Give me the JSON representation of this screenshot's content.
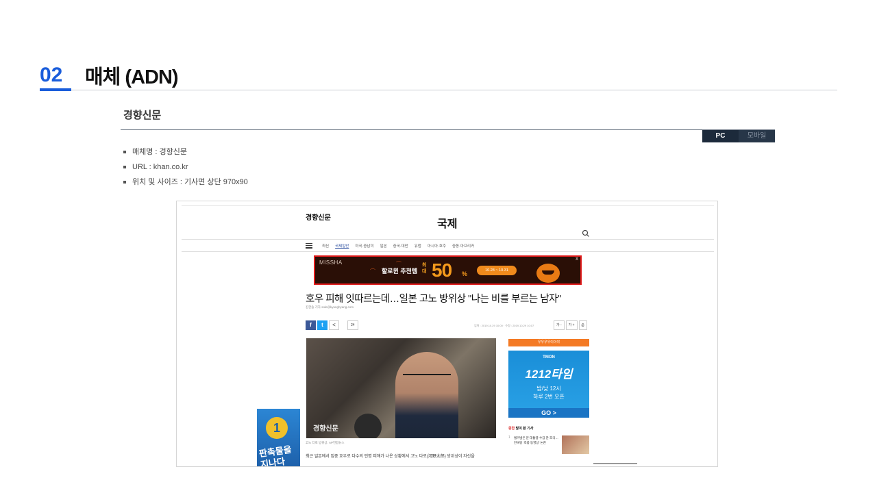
{
  "header": {
    "number": "02",
    "title": "매체 (ADN)"
  },
  "media": {
    "name": "경향신문",
    "tabs": {
      "pc": "PC",
      "mobile": "모바일"
    },
    "info": [
      "매체명 : 경향신문",
      "URL : khan.co.kr",
      "위치 및 사이즈 : 기사면 상단 970x90"
    ]
  },
  "screenshot": {
    "logo": "경향신문",
    "section": "국제",
    "nav": [
      "최신",
      "국제일반",
      "미국·중남미",
      "일본",
      "중국·대만",
      "유럽",
      "아시아·호주",
      "중동·아프리카"
    ],
    "ad": {
      "brand": "MISSHA",
      "text": "할로윈 추천템",
      "badge": "최대",
      "big": "50",
      "pct": "%",
      "dates": "10.28 ~ 10.31",
      "close": "X"
    },
    "headline": "호우 피해 잇따르는데…일본 고노 방위상 \"나는 비를 부르는 남자\"",
    "byline": "김한솔 기자 sole@kyunghyang.com",
    "share": {
      "fb": "f",
      "tw": "t",
      "more": "<",
      "comment": "24"
    },
    "dates": "입력 : 2019.10.29 10:00 · 수정 : 2019.10.29 10:07",
    "tools": [
      "가 -",
      "가 +",
      "⎙"
    ],
    "photo_watermark": "경향신문",
    "caption": "고노 다로 방위상. AP연합뉴스",
    "body": "최근 일본에서 집중 호우로 다수의 인명 피해가 나온 상황에서 고노 다로(河野太郎) 방위상이 자신을",
    "side": {
      "bar": "우우우우이이야",
      "ad_brand": "TMON",
      "ad_title": "1212타임",
      "ad_sub1": "밤/낮 12시",
      "ad_sub2": "하루 2번 오픈",
      "ad_go": "GO >",
      "popular_accent": "종합",
      "popular": " 많이 본 기사",
      "item_num": "1",
      "item_text": "벌거벗은 문 대통령·수갑 찬 조국…한국당 '조롱 동영상' 논란"
    },
    "left_ad": {
      "medal": "1",
      "text": "판촉물을 지나다"
    }
  },
  "colors": {
    "accent": "#1a5ddb",
    "ad_border": "#e01a1a",
    "tab_active": "#1c2a3b"
  }
}
